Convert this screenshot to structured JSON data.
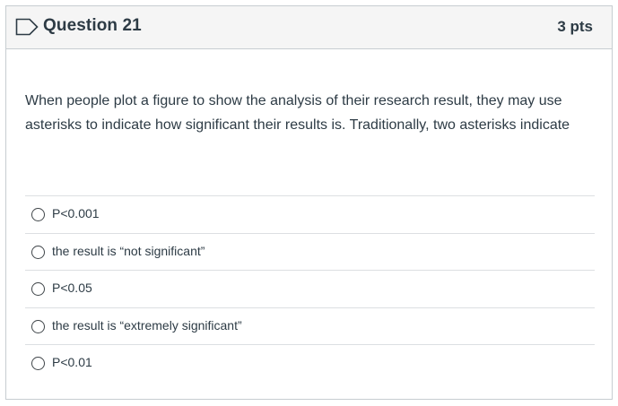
{
  "question": {
    "title": "Question 21",
    "points": "3 pts",
    "text": "When people plot a figure to show the analysis of their research result, they may use asterisks to indicate how significant their results is. Traditionally, two asterisks indicate"
  },
  "answers": [
    {
      "label": "P<0.001",
      "selected": false
    },
    {
      "label": "the result is “not significant”",
      "selected": false
    },
    {
      "label": "P<0.05",
      "selected": false
    },
    {
      "label": "the result is “extremely significant”",
      "selected": false
    },
    {
      "label": "P<0.01",
      "selected": false
    }
  ],
  "colors": {
    "header_bg": "#f5f5f5",
    "border": "#c7cdd1",
    "text": "#2d3b45"
  },
  "icons": {
    "header": "bookmark-icon"
  }
}
